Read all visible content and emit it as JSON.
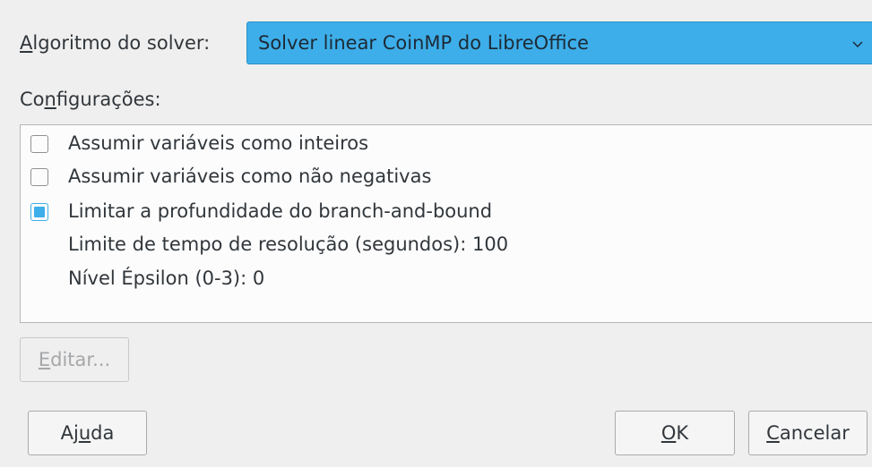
{
  "solver": {
    "label_prefix": "",
    "label_mnemonic": "A",
    "label_rest": "lgoritmo do solver:",
    "selected": "Solver linear CoinMP do LibreOffice"
  },
  "settings": {
    "label_prefix": "Co",
    "label_mnemonic": "n",
    "label_rest": "figurações:",
    "items": [
      {
        "text": "Assumir variáveis como inteiros",
        "type": "checkbox",
        "checked": false
      },
      {
        "text": "Assumir variáveis como não negativas",
        "type": "checkbox",
        "checked": false
      },
      {
        "text": "Limitar a profundidade do branch-and-bound",
        "type": "checkbox",
        "checked": true
      },
      {
        "text": "Limite de tempo de resolução (segundos): 100",
        "type": "value"
      },
      {
        "text": "Nível Épsilon (0-3): 0",
        "type": "value"
      }
    ]
  },
  "buttons": {
    "edit": {
      "prefix": "",
      "mnemonic": "E",
      "rest": "ditar...",
      "enabled": false
    },
    "help": {
      "prefix": "Aj",
      "mnemonic": "u",
      "rest": "da"
    },
    "ok": {
      "prefix": "",
      "mnemonic": "O",
      "rest": "K"
    },
    "cancel": {
      "prefix": "",
      "mnemonic": "C",
      "rest": "ancelar"
    }
  },
  "colors": {
    "accent": "#3daee9",
    "window_bg": "#efefef",
    "list_bg": "#fcfcfc",
    "text": "#31363b",
    "disabled_text": "#a5a7a9"
  },
  "icons": {
    "combo_arrow": "chevron-down-icon"
  }
}
